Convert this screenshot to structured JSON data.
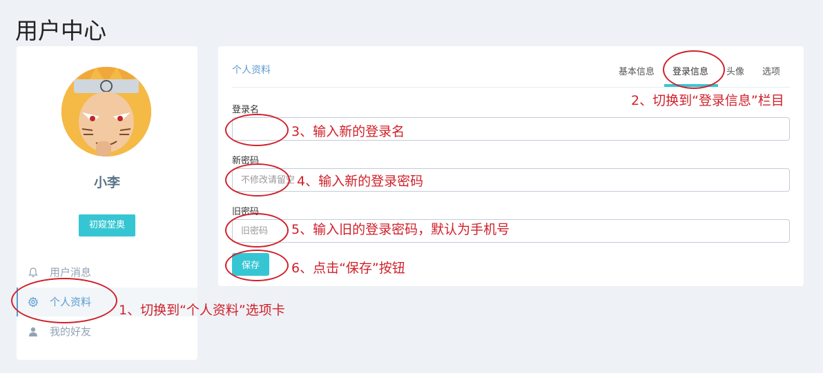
{
  "page_title": "用户中心",
  "profile": {
    "username": "小李",
    "level_badge": "初窥堂奥"
  },
  "sidebar": {
    "items": [
      {
        "label": "用户消息",
        "icon": "bell-icon"
      },
      {
        "label": "个人资料",
        "icon": "gear-icon",
        "active": true
      },
      {
        "label": "我的好友",
        "icon": "user-icon"
      }
    ]
  },
  "card": {
    "caption": "个人资料",
    "tabs": [
      "基本信息",
      "登录信息",
      "头像",
      "选项"
    ],
    "active_tab": "登录信息"
  },
  "form": {
    "login_name_label": "登录名",
    "login_name_value": "",
    "new_password_label": "新密码",
    "new_password_placeholder": "不修改请留空",
    "old_password_label": "旧密码",
    "old_password_placeholder": "旧密码",
    "save_label": "保存"
  },
  "annotations": {
    "step1": "1、切换到“个人资料”选项卡",
    "step2": "2、切换到“登录信息”栏目",
    "step3": "3、输入新的登录名",
    "step4": "4、输入新的登录密码",
    "step5": "5、输入旧的登录密码，默认为手机号",
    "step6": "6、点击“保存”按钮"
  },
  "colors": {
    "accent": "#36c6d3",
    "annotation": "#d0202a",
    "link": "#5c9bd1"
  }
}
